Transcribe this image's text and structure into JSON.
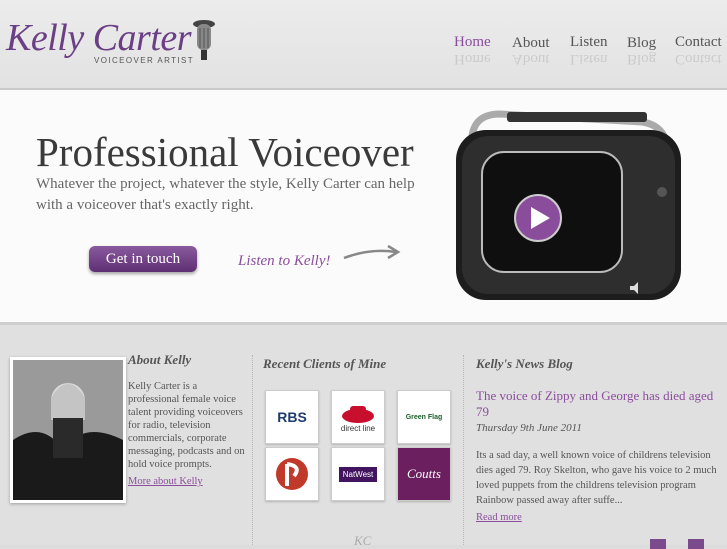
{
  "brand": {
    "name": "Kelly Carter",
    "tagline": "VOICEOVER ARTIST",
    "accent": "#8a4d9c"
  },
  "nav": [
    {
      "label": "Home",
      "active": true
    },
    {
      "label": "About",
      "active": false
    },
    {
      "label": "Listen",
      "active": false
    },
    {
      "label": "Blog",
      "active": false
    },
    {
      "label": "Contact",
      "active": false
    }
  ],
  "hero": {
    "title": "Professional Voiceover",
    "subtitle": "Whatever the project, whatever the style, Kelly Carter can help with a voiceover that's exactly right.",
    "cta_label": "Get in touch",
    "listen_label": "Listen to Kelly!"
  },
  "about": {
    "heading": "About Kelly",
    "text": "Kelly Carter is a professional female voice talent providing voiceovers for radio, television commercials, corporate messaging, podcasts and on hold voice prompts.",
    "more_label": "More about Kelly"
  },
  "clients": {
    "heading": "Recent Clients of Mine",
    "logos": [
      "RBS",
      "direct line",
      "Green Flag",
      "NatWest",
      "Coutts"
    ]
  },
  "blog": {
    "heading": "Kelly's News Blog",
    "post_title": "The voice of Zippy and George has died aged 79",
    "post_date": "Thursday 9th June 2011",
    "post_excerpt": "Its a sad day, a well known voice of childrens television dies aged 79. Roy Skelton, who gave his voice to 2 much loved puppets from the childrens television program Rainbow passed away after suffe...",
    "read_more_label": "Read more"
  },
  "footer": {
    "monogram": "KC"
  }
}
